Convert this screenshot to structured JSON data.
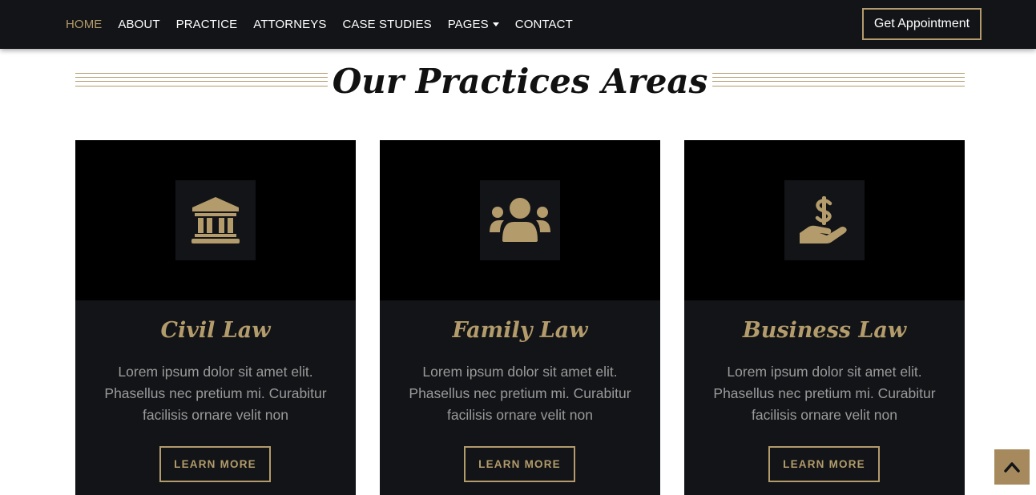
{
  "nav": {
    "items": [
      {
        "label": "HOME",
        "active": true
      },
      {
        "label": "ABOUT"
      },
      {
        "label": "PRACTICE"
      },
      {
        "label": "ATTORNEYS"
      },
      {
        "label": "CASE STUDIES"
      },
      {
        "label": "PAGES",
        "dropdown": true
      },
      {
        "label": "CONTACT"
      }
    ],
    "cta": "Get Appointment"
  },
  "section": {
    "title": "Our Practices Areas"
  },
  "cards": [
    {
      "icon": "landmark-icon",
      "title": "Civil Law",
      "text": "Lorem ipsum dolor sit amet elit. Phasellus nec pretium mi. Curabitur facilisis ornare velit non",
      "button": "LEARN MORE"
    },
    {
      "icon": "users-icon",
      "title": "Family Law",
      "text": "Lorem ipsum dolor sit amet elit. Phasellus nec pretium mi. Curabitur facilisis ornare velit non",
      "button": "LEARN MORE"
    },
    {
      "icon": "hand-holding-dollar-icon",
      "title": "Business Law",
      "text": "Lorem ipsum dolor sit amet elit. Phasellus nec pretium mi. Curabitur facilisis ornare velit non",
      "button": "LEARN MORE"
    }
  ],
  "colors": {
    "accent": "#b39b6b",
    "nav_bg": "#121417",
    "card_bg": "#121417",
    "card_top": "#000000",
    "back_to_top": "#a68a5e"
  },
  "back_to_top": {
    "icon": "chevron-up-icon"
  }
}
